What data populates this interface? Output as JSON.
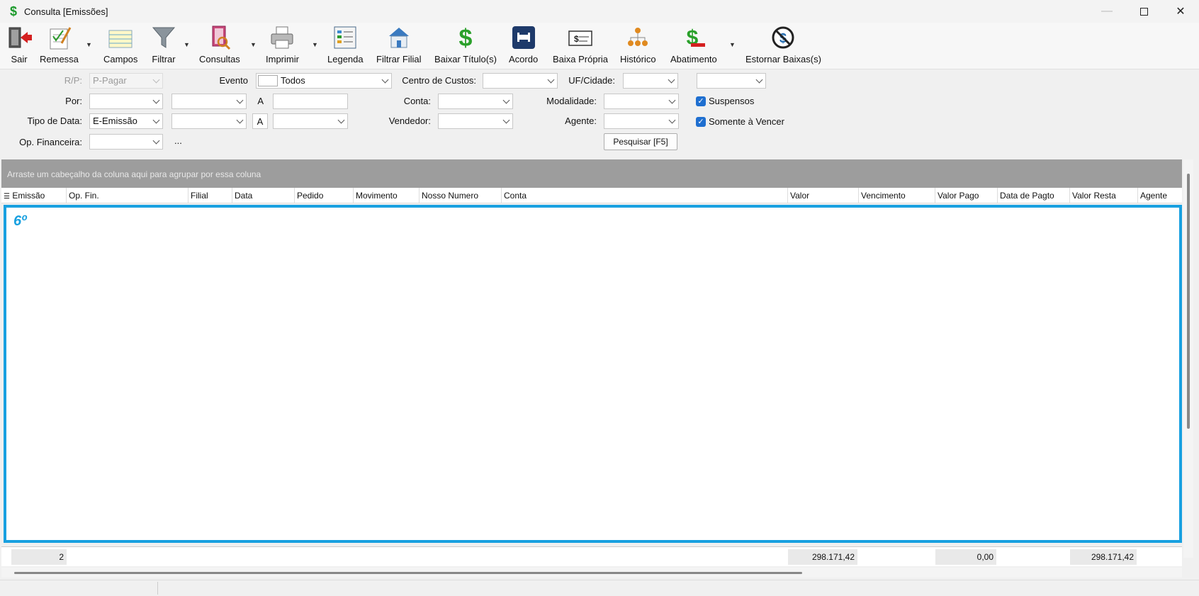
{
  "window": {
    "title": "Consulta [Emissões]"
  },
  "toolbar": {
    "items": [
      {
        "label": "Sair"
      },
      {
        "label": "Remessa"
      },
      {
        "label": "Campos"
      },
      {
        "label": "Filtrar"
      },
      {
        "label": "Consultas"
      },
      {
        "label": "Imprimir"
      },
      {
        "label": "Legenda"
      },
      {
        "label": "Filtrar Filial"
      },
      {
        "label": "Baixar Título(s)"
      },
      {
        "label": "Acordo"
      },
      {
        "label": "Baixa Própria"
      },
      {
        "label": "Histórico"
      },
      {
        "label": "Abatimento"
      },
      {
        "label": "Estornar Baixas(s)"
      }
    ]
  },
  "filters": {
    "rp_label": "R/P:",
    "rp_value": "P-Pagar",
    "evento_label": "Evento",
    "evento_value": "Todos",
    "centro_label": "Centro de Custos:",
    "uf_label": "UF/Cidade:",
    "por_label": "Por:",
    "a_label": "A",
    "conta_label": "Conta:",
    "modalidade_label": "Modalidade:",
    "suspensos_label": "Suspensos",
    "tipo_label": "Tipo de Data:",
    "tipo_value": "E-Emissão",
    "a2_label": "A",
    "vendedor_label": "Vendedor:",
    "agente_label": "Agente:",
    "somente_label": "Somente à Vencer",
    "opfin_label": "Op. Financeira:",
    "ellipsis": "...",
    "pesquisar_label": "Pesquisar [F5]"
  },
  "grid": {
    "group_hint": "Arraste um cabeçalho da coluna aqui para agrupar por essa coluna",
    "columns": [
      "Emissão",
      "Op. Fin.",
      "Filial",
      "Data",
      "Pedido",
      "Movimento",
      "Nosso Numero",
      "Conta",
      "Valor",
      "Vencimento",
      "Valor Pago",
      "Data de Pagto",
      "Valor Resta",
      "Agente"
    ],
    "annotation": "6º"
  },
  "footer": {
    "count": "2",
    "valor": "298.171,42",
    "valor_pago": "0,00",
    "valor_resta": "298.171,42"
  },
  "colors": {
    "accent": "#18a0e0",
    "group_bar": "#9d9d9d",
    "checkbox": "#1f6fd0"
  }
}
